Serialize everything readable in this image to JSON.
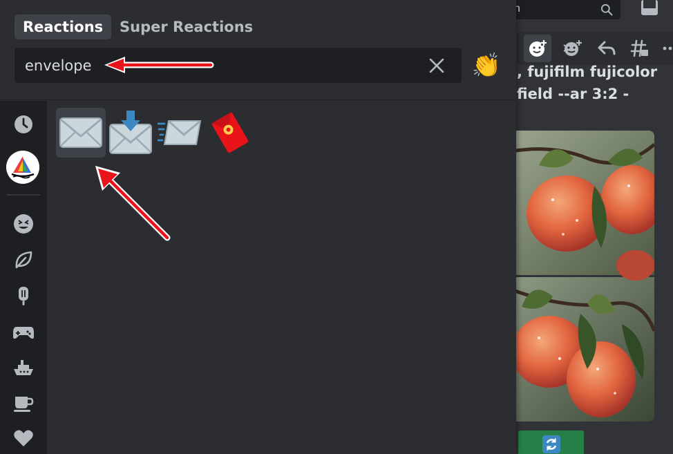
{
  "picker": {
    "tabs": [
      {
        "label": "Reactions",
        "active": true
      },
      {
        "label": "Super Reactions",
        "active": false
      }
    ],
    "search": {
      "value": "envelope",
      "placeholder": ""
    },
    "diversity_emoji": "👏",
    "categories": [
      "clock-icon",
      "server-emoji-icon",
      "smiley-icon",
      "leaf-icon",
      "popsicle-icon",
      "game-controller-icon",
      "ship-icon",
      "coffee-icon",
      "heart-icon"
    ],
    "results": [
      {
        "name": "envelope",
        "selected": true
      },
      {
        "name": "envelope_with_arrow",
        "selected": false
      },
      {
        "name": "incoming_envelope",
        "selected": false
      },
      {
        "name": "red_envelope",
        "selected": false
      }
    ]
  },
  "background": {
    "search_text": "h",
    "message_line1": ", fujifilm fujicolor",
    "message_line2": "field --ar 3:2 -"
  },
  "colors": {
    "accent_red": "#e8141a",
    "picker_bg": "#2b2d31",
    "sidebar_bg": "#1e1f22",
    "button_green": "#248046"
  }
}
